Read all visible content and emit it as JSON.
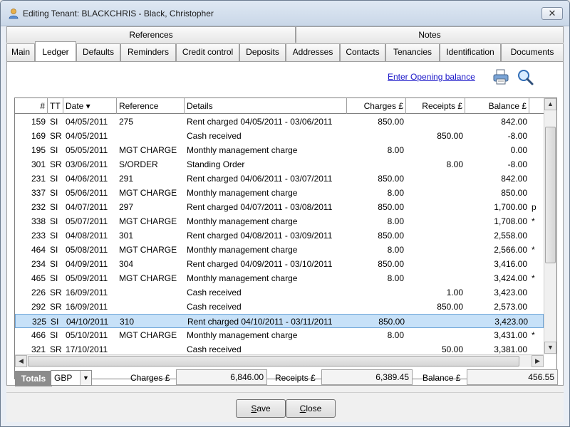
{
  "window": {
    "title": "Editing Tenant: BLACKCHRIS - Black, Christopher",
    "close_label": "✕"
  },
  "tabs_top": [
    {
      "label": "References"
    },
    {
      "label": "Notes"
    }
  ],
  "tabs_bottom": [
    {
      "label": "Main"
    },
    {
      "label": "Ledger",
      "active": true
    },
    {
      "label": "Defaults"
    },
    {
      "label": "Reminders"
    },
    {
      "label": "Credit control"
    },
    {
      "label": "Deposits"
    },
    {
      "label": "Addresses"
    },
    {
      "label": "Contacts"
    },
    {
      "label": "Tenancies"
    },
    {
      "label": "Identification"
    },
    {
      "label": "Documents"
    }
  ],
  "ledger": {
    "opening_balance_link": "Enter Opening balance",
    "icons": [
      "print-icon",
      "magnifier-icon"
    ],
    "columns": [
      "#",
      "TT",
      "Date ▾",
      "Reference",
      "Details",
      "Charges £",
      "Receipts £",
      "Balance £"
    ],
    "rows": [
      {
        "num": "159",
        "tt": "SI",
        "date": "04/05/2011",
        "ref": "275",
        "details": "Rent charged 04/05/2011 - 03/06/2011",
        "charges": "850.00",
        "receipts": "",
        "balance": "842.00",
        "flag": ""
      },
      {
        "num": "169",
        "tt": "SR",
        "date": "04/05/2011",
        "ref": "",
        "details": "Cash received",
        "charges": "",
        "receipts": "850.00",
        "balance": "-8.00",
        "flag": ""
      },
      {
        "num": "195",
        "tt": "SI",
        "date": "05/05/2011",
        "ref": "MGT CHARGE",
        "details": "Monthly management charge",
        "charges": "8.00",
        "receipts": "",
        "balance": "0.00",
        "flag": ""
      },
      {
        "num": "301",
        "tt": "SR",
        "date": "03/06/2011",
        "ref": "S/ORDER",
        "details": "Standing Order",
        "charges": "",
        "receipts": "8.00",
        "balance": "-8.00",
        "flag": ""
      },
      {
        "num": "231",
        "tt": "SI",
        "date": "04/06/2011",
        "ref": "291",
        "details": "Rent charged 04/06/2011 - 03/07/2011",
        "charges": "850.00",
        "receipts": "",
        "balance": "842.00",
        "flag": ""
      },
      {
        "num": "337",
        "tt": "SI",
        "date": "05/06/2011",
        "ref": "MGT CHARGE",
        "details": "Monthly management charge",
        "charges": "8.00",
        "receipts": "",
        "balance": "850.00",
        "flag": ""
      },
      {
        "num": "232",
        "tt": "SI",
        "date": "04/07/2011",
        "ref": "297",
        "details": "Rent charged 04/07/2011 - 03/08/2011",
        "charges": "850.00",
        "receipts": "",
        "balance": "1,700.00",
        "flag": "p"
      },
      {
        "num": "338",
        "tt": "SI",
        "date": "05/07/2011",
        "ref": "MGT CHARGE",
        "details": "Monthly management charge",
        "charges": "8.00",
        "receipts": "",
        "balance": "1,708.00",
        "flag": "*"
      },
      {
        "num": "233",
        "tt": "SI",
        "date": "04/08/2011",
        "ref": "301",
        "details": "Rent charged 04/08/2011 - 03/09/2011",
        "charges": "850.00",
        "receipts": "",
        "balance": "2,558.00",
        "flag": ""
      },
      {
        "num": "464",
        "tt": "SI",
        "date": "05/08/2011",
        "ref": "MGT CHARGE",
        "details": "Monthly management charge",
        "charges": "8.00",
        "receipts": "",
        "balance": "2,566.00",
        "flag": "*"
      },
      {
        "num": "234",
        "tt": "SI",
        "date": "04/09/2011",
        "ref": "304",
        "details": "Rent charged 04/09/2011 - 03/10/2011",
        "charges": "850.00",
        "receipts": "",
        "balance": "3,416.00",
        "flag": ""
      },
      {
        "num": "465",
        "tt": "SI",
        "date": "05/09/2011",
        "ref": "MGT CHARGE",
        "details": "Monthly management charge",
        "charges": "8.00",
        "receipts": "",
        "balance": "3,424.00",
        "flag": "*"
      },
      {
        "num": "226",
        "tt": "SR",
        "date": "16/09/2011",
        "ref": "",
        "details": "Cash received",
        "charges": "",
        "receipts": "1.00",
        "balance": "3,423.00",
        "flag": ""
      },
      {
        "num": "292",
        "tt": "SR",
        "date": "16/09/2011",
        "ref": "",
        "details": "Cash received",
        "charges": "",
        "receipts": "850.00",
        "balance": "2,573.00",
        "flag": ""
      },
      {
        "num": "325",
        "tt": "SI",
        "date": "04/10/2011",
        "ref": "310",
        "details": "Rent charged 04/10/2011 - 03/11/2011",
        "charges": "850.00",
        "receipts": "",
        "balance": "3,423.00",
        "flag": "",
        "selected": true
      },
      {
        "num": "466",
        "tt": "SI",
        "date": "05/10/2011",
        "ref": "MGT CHARGE",
        "details": "Monthly management charge",
        "charges": "8.00",
        "receipts": "",
        "balance": "3,431.00",
        "flag": "*"
      },
      {
        "num": "321",
        "tt": "SR",
        "date": "17/10/2011",
        "ref": "",
        "details": "Cash received",
        "charges": "",
        "receipts": "50.00",
        "balance": "3,381.00",
        "flag": ""
      }
    ]
  },
  "totals": {
    "label": "Totals",
    "currency": "GBP",
    "charges_label": "Charges £",
    "charges_value": "6,846.00",
    "receipts_label": "Receipts £",
    "receipts_value": "6,389.45",
    "balance_label": "Balance £",
    "balance_value": "456.55"
  },
  "buttons": {
    "save_first": "S",
    "save_rest": "ave",
    "close_first": "C",
    "close_rest": "lose"
  },
  "colors": {
    "selected_row": "#c7e1f8",
    "link": "#1a16c8",
    "totals_label_bg": "#8c8c8c"
  }
}
